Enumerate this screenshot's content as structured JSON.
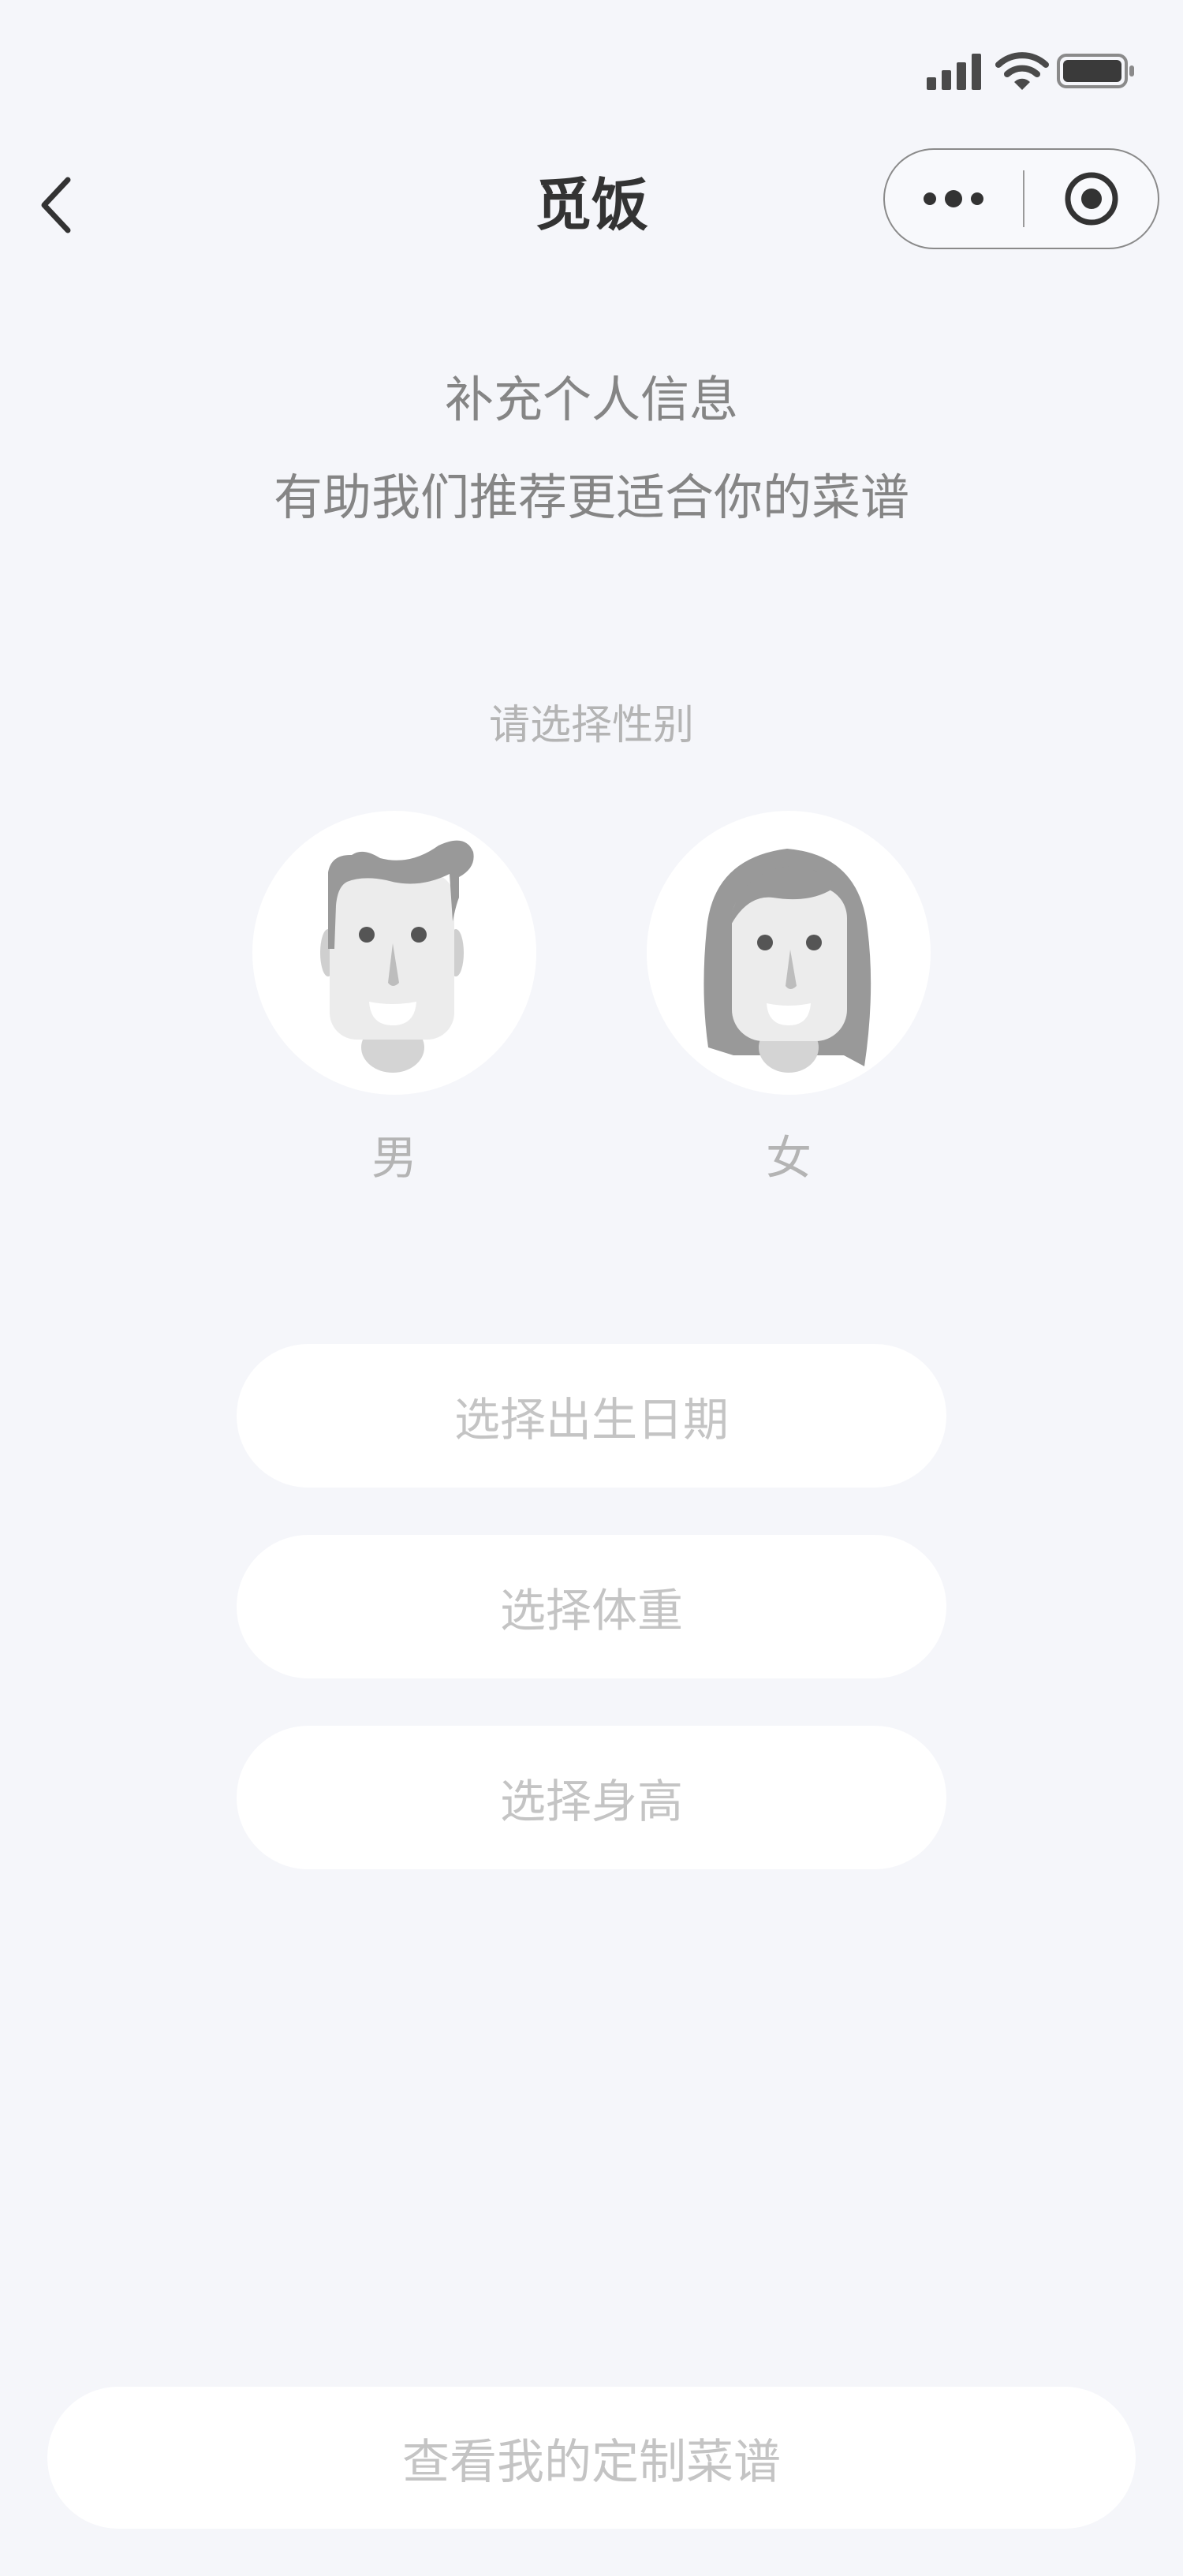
{
  "status_bar": {
    "signal_icon": "cellular-signal-icon",
    "wifi_icon": "wifi-icon",
    "battery_icon": "battery-icon"
  },
  "nav": {
    "back_icon": "chevron-left-icon",
    "title": "觅饭",
    "more_icon": "more-dots-icon",
    "close_icon": "record-circle-icon"
  },
  "intro": {
    "line1": "补充个人信息",
    "line2": "有助我们推荐更适合你的菜谱"
  },
  "gender": {
    "prompt": "请选择性别",
    "options": [
      {
        "label": "男",
        "icon": "male-avatar-icon"
      },
      {
        "label": "女",
        "icon": "female-avatar-icon"
      }
    ]
  },
  "fields": {
    "birth_date": "选择出生日期",
    "weight": "选择体重",
    "height": "选择身高"
  },
  "submit": {
    "label": "查看我的定制菜谱"
  },
  "colors": {
    "background": "#f5f6fa",
    "title": "#333333",
    "intro_text": "#858585",
    "placeholder_text": "#c4c4c4",
    "avatar_hair": "#9a9a9a",
    "avatar_skin": "#ececec"
  }
}
